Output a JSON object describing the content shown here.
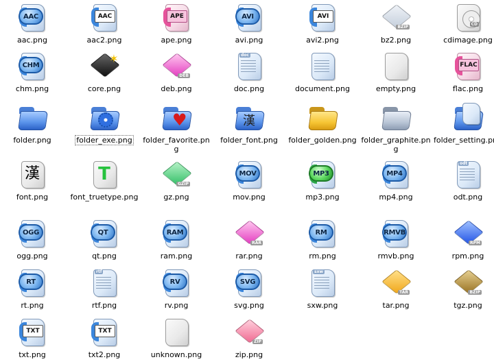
{
  "files": [
    {
      "label": "aac.png",
      "icon": "aac-icon",
      "kind": "bubble",
      "text": "AAC"
    },
    {
      "label": "aac2.png",
      "icon": "aac2-icon",
      "kind": "tag",
      "text": "AAC"
    },
    {
      "label": "ape.png",
      "icon": "ape-icon",
      "kind": "tagpink",
      "text": "APE"
    },
    {
      "label": "avi.png",
      "icon": "avi-icon",
      "kind": "bubble",
      "text": "AVI"
    },
    {
      "label": "avi2.png",
      "icon": "avi2-icon",
      "kind": "tag",
      "text": "AVI"
    },
    {
      "label": "bz2.png",
      "icon": "bz2-icon",
      "kind": "cube",
      "color": "c-grey",
      "tag": "BZIP"
    },
    {
      "label": "cdimage.png",
      "icon": "cdimage-icon",
      "kind": "cd",
      "text": "CD"
    },
    {
      "label": "chm.png",
      "icon": "chm-icon",
      "kind": "bubble",
      "text": "CHM"
    },
    {
      "label": "core.png",
      "icon": "core-icon",
      "kind": "cube",
      "color": "c-black",
      "tag": ""
    },
    {
      "label": "deb.png",
      "icon": "deb-icon",
      "kind": "cube",
      "color": "c-pink",
      "tag": "DEB"
    },
    {
      "label": "doc.png",
      "icon": "doc-icon",
      "kind": "doc",
      "text": "doc"
    },
    {
      "label": "document.png",
      "icon": "document-icon",
      "kind": "doc",
      "text": ""
    },
    {
      "label": "empty.png",
      "icon": "empty-icon",
      "kind": "empty",
      "text": ""
    },
    {
      "label": "flac.png",
      "icon": "flac-icon",
      "kind": "tagpink",
      "text": "FLAC"
    },
    {
      "label": "folder.png",
      "icon": "folder-icon",
      "kind": "folder",
      "color": "fb-blue"
    },
    {
      "label": "folder_exe.png",
      "icon": "folder-exe-icon",
      "kind": "folder-exe",
      "color": "fb-blue",
      "selected": true
    },
    {
      "label": "folder_favorite.png",
      "icon": "folder-favorite-icon",
      "kind": "folder-fav",
      "color": "fb-blue"
    },
    {
      "label": "folder_font.png",
      "icon": "folder-font-icon",
      "kind": "folder-font",
      "color": "fb-blue",
      "text": "漢"
    },
    {
      "label": "folder_golden.png",
      "icon": "folder-golden-icon",
      "kind": "folder",
      "color": "fb-gold"
    },
    {
      "label": "folder_graphite.png",
      "icon": "folder-graphite-icon",
      "kind": "folder",
      "color": "fb-grey"
    },
    {
      "label": "folder_setting.png",
      "icon": "folder-setting-icon",
      "kind": "folder-page",
      "color": "fb-blue"
    },
    {
      "label": "font.png",
      "icon": "font-icon",
      "kind": "glyphpage",
      "text": "漢"
    },
    {
      "label": "font_truetype.png",
      "icon": "font-truetype-icon",
      "kind": "glyphpage-green",
      "text": "T"
    },
    {
      "label": "gz.png",
      "icon": "gz-icon",
      "kind": "cube",
      "color": "c-green",
      "tag": "GZIP"
    },
    {
      "label": "mov.png",
      "icon": "mov-icon",
      "kind": "bubble",
      "text": "MOV"
    },
    {
      "label": "mp3.png",
      "icon": "mp3-icon",
      "kind": "bubble-green",
      "text": "MP3"
    },
    {
      "label": "mp4.png",
      "icon": "mp4-icon",
      "kind": "bubble",
      "text": "MP4"
    },
    {
      "label": "odt.png",
      "icon": "odt-icon",
      "kind": "doc",
      "text": "odt"
    },
    {
      "label": "ogg.png",
      "icon": "ogg-icon",
      "kind": "bubble",
      "text": "OGG"
    },
    {
      "label": "qt.png",
      "icon": "qt-icon",
      "kind": "bubble",
      "text": "QT"
    },
    {
      "label": "ram.png",
      "icon": "ram-icon",
      "kind": "bubble",
      "text": "RAM"
    },
    {
      "label": "rar.png",
      "icon": "rar-icon",
      "kind": "cube",
      "color": "c-pink",
      "tag": "RAR"
    },
    {
      "label": "rm.png",
      "icon": "rm-icon",
      "kind": "bubble",
      "text": "RM"
    },
    {
      "label": "rmvb.png",
      "icon": "rmvb-icon",
      "kind": "bubble",
      "text": "RMVB"
    },
    {
      "label": "rpm.png",
      "icon": "rpm-icon",
      "kind": "cube",
      "color": "c-purple",
      "tag": "RPM"
    },
    {
      "label": "rt.png",
      "icon": "rt-icon",
      "kind": "bubble",
      "text": "RT"
    },
    {
      "label": "rtf.png",
      "icon": "rtf-icon",
      "kind": "doc",
      "text": "rtf"
    },
    {
      "label": "rv.png",
      "icon": "rv-icon",
      "kind": "bubble",
      "text": "RV"
    },
    {
      "label": "svg.png",
      "icon": "svg-icon",
      "kind": "bubble",
      "text": "SVG"
    },
    {
      "label": "sxw.png",
      "icon": "sxw-icon",
      "kind": "doc",
      "text": "sxw"
    },
    {
      "label": "tar.png",
      "icon": "tar-icon",
      "kind": "cube",
      "color": "c-orange",
      "tag": "TAR"
    },
    {
      "label": "tgz.png",
      "icon": "tgz-icon",
      "kind": "cube",
      "color": "c-brown",
      "tag": "BZIP"
    },
    {
      "label": "txt.png",
      "icon": "txt-icon",
      "kind": "tag",
      "text": "TXT"
    },
    {
      "label": "txt2.png",
      "icon": "txt2-icon",
      "kind": "tag",
      "text": "TXT"
    },
    {
      "label": "unknown.png",
      "icon": "unknown-icon",
      "kind": "empty",
      "text": ""
    },
    {
      "label": "zip.png",
      "icon": "zip-icon",
      "kind": "cube",
      "color": "c-rose",
      "tag": "ZIP"
    }
  ]
}
